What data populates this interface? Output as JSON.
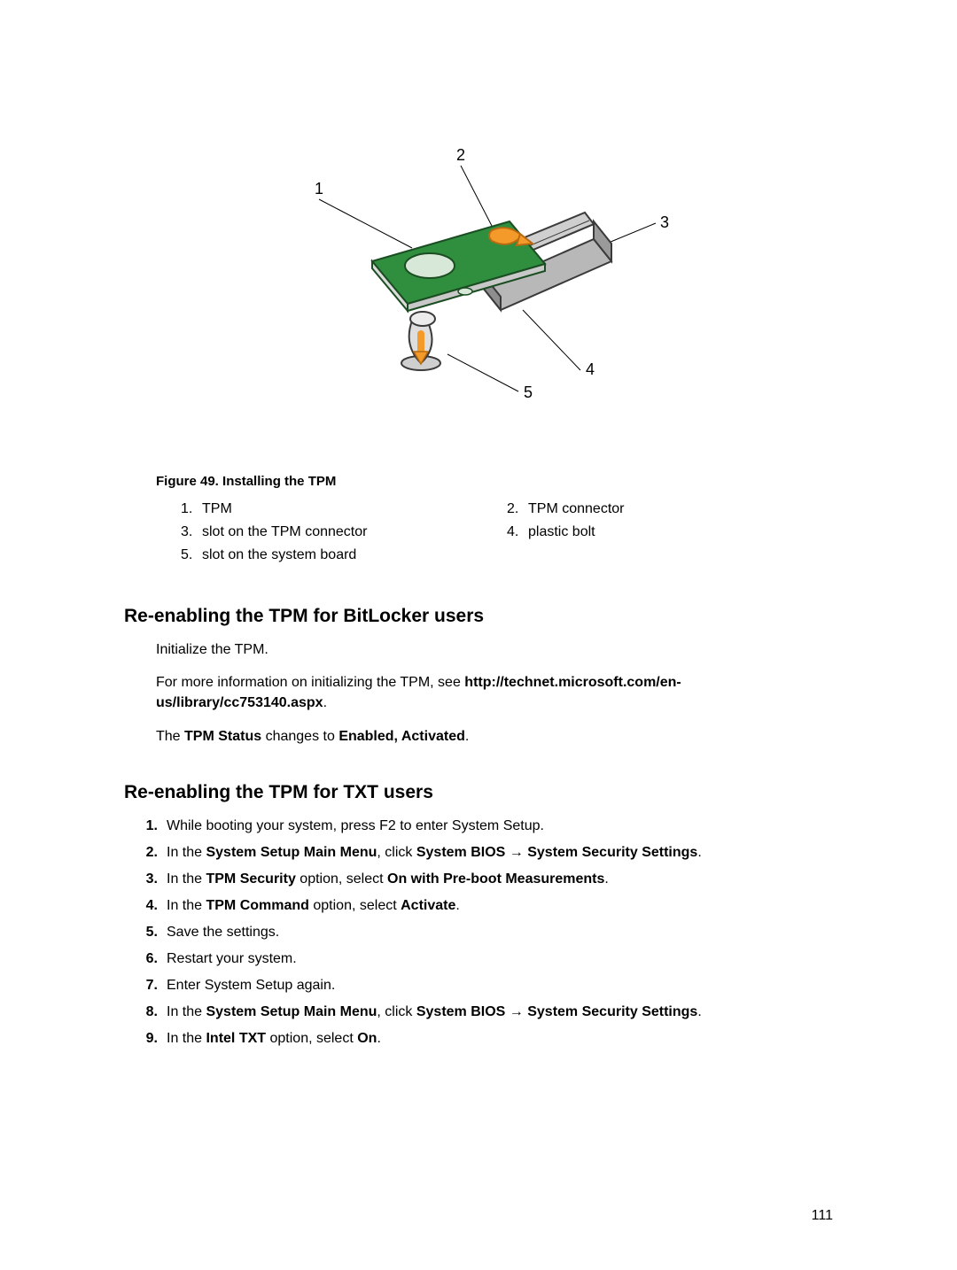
{
  "figure": {
    "labels": {
      "n1": "1",
      "n2": "2",
      "n3": "3",
      "n4": "4",
      "n5": "5"
    },
    "caption": "Figure 49. Installing the TPM",
    "legend": {
      "left": [
        {
          "n": "1.",
          "t": "TPM"
        },
        {
          "n": "3.",
          "t": "slot on the TPM connector"
        },
        {
          "n": "5.",
          "t": "slot on the system board"
        }
      ],
      "right": [
        {
          "n": "2.",
          "t": "TPM connector"
        },
        {
          "n": "4.",
          "t": "plastic bolt"
        }
      ]
    }
  },
  "section1": {
    "heading": "Re-enabling the TPM for BitLocker users",
    "p1": "Initialize the TPM.",
    "p2a": "For more information on initializing the TPM, see ",
    "p2b": "http://technet.microsoft.com/en-us/library/cc753140.aspx",
    "p2c": ".",
    "p3a": "The ",
    "p3b": "TPM Status",
    "p3c": " changes to ",
    "p3d": "Enabled, Activated",
    "p3e": "."
  },
  "section2": {
    "heading": "Re-enabling the TPM for TXT users",
    "steps": [
      {
        "n": "1.",
        "pre": "While booting your system, press F2 to enter System Setup."
      },
      {
        "n": "2.",
        "pre": "In the ",
        "b1": "System Setup Main Menu",
        "mid": ", click ",
        "b2": "System BIOS → System Security Settings",
        "post": "."
      },
      {
        "n": "3.",
        "pre": "In the ",
        "b1": "TPM Security",
        "mid": " option, select ",
        "b2": "On with Pre-boot Measurements",
        "post": "."
      },
      {
        "n": "4.",
        "pre": "In the ",
        "b1": "TPM Command",
        "mid": " option, select ",
        "b2": "Activate",
        "post": "."
      },
      {
        "n": "5.",
        "pre": "Save the settings."
      },
      {
        "n": "6.",
        "pre": "Restart your system."
      },
      {
        "n": "7.",
        "pre": "Enter System Setup again."
      },
      {
        "n": "8.",
        "pre": "In the ",
        "b1": "System Setup Main Menu",
        "mid": ", click ",
        "b2": "System BIOS → System Security Settings",
        "post": "."
      },
      {
        "n": "9.",
        "pre": "In the ",
        "b1": "Intel TXT",
        "mid": " option, select ",
        "b2": "On",
        "post": "."
      }
    ]
  },
  "page_number": "111"
}
